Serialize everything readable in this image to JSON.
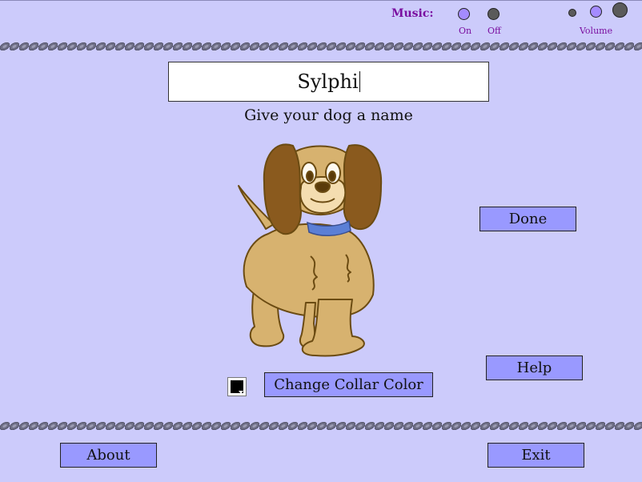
{
  "music": {
    "label": "Music:",
    "on_label": "On",
    "off_label": "Off",
    "volume_label": "Volume",
    "selected": "on",
    "volume_level": "medium"
  },
  "name_field": {
    "value": "Sylphi",
    "hint": "Give your dog a name"
  },
  "buttons": {
    "done": "Done",
    "help": "Help",
    "change_collar": "Change Collar Color",
    "about": "About",
    "exit": "Exit"
  },
  "collar": {
    "swatch_color": "#000000",
    "dog_collar_color": "#5b7fd6"
  },
  "colors": {
    "background": "#cccbfb",
    "button": "#9999ff",
    "accent_text": "#7a0fa0",
    "dog_fur": "#d7b26f",
    "dog_ears": "#8a5a1e"
  }
}
